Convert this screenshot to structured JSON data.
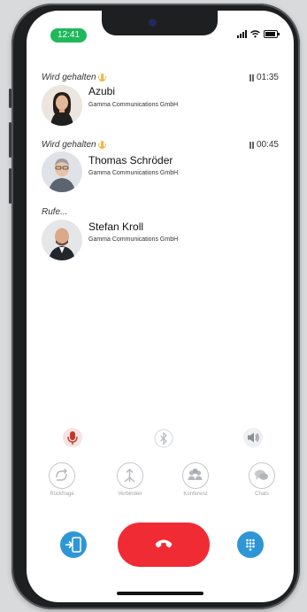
{
  "status_bar": {
    "time": "12:41"
  },
  "calls": [
    {
      "state": "Wird gehalten",
      "timer": "01:35",
      "name": "Azubi",
      "company": "Gamma Communications GmbH"
    },
    {
      "state": "Wird gehalten",
      "timer": "00:45",
      "name": "Thomas Schröder",
      "company": "Gamma Communications GmbH"
    },
    {
      "state": "Rufe...",
      "name": "Stefan Kroll",
      "company": "Gamma Communications GmbH"
    }
  ],
  "controls": {
    "mute": {
      "icon": "microphone-icon",
      "active_color": "#c0392b"
    },
    "bluetooth": {
      "icon": "bluetooth-icon"
    },
    "speaker": {
      "icon": "speaker-icon"
    }
  },
  "actions": [
    {
      "label": "Rückfrage",
      "icon": "consult-icon"
    },
    {
      "label": "Verbinden",
      "icon": "transfer-icon"
    },
    {
      "label": "Konferenz",
      "icon": "conference-icon"
    },
    {
      "label": "Chats",
      "icon": "chat-icon"
    }
  ],
  "bottom_bar": {
    "left": {
      "icon": "switch-device-icon"
    },
    "end_call": {
      "icon": "phone-hangup-icon",
      "color": "#f02b34"
    },
    "right": {
      "icon": "dialpad-icon"
    }
  },
  "colors": {
    "accent": "#2e96d6",
    "hold": "#f3b640",
    "time_pill": "#1fb85a"
  }
}
